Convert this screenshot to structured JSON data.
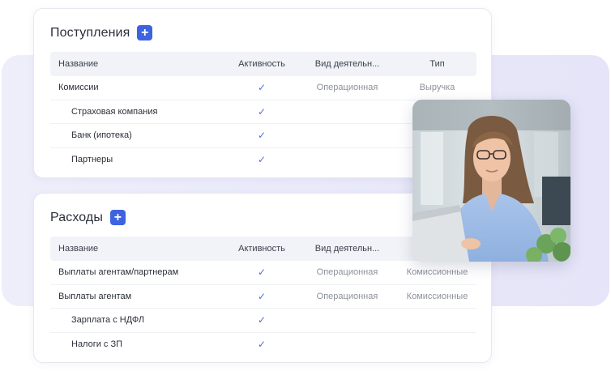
{
  "income": {
    "title": "Поступления",
    "add_icon": "+",
    "columns": {
      "name": "Название",
      "active": "Активность",
      "kind": "Вид деятельн...",
      "type": "Тип"
    },
    "rows": [
      {
        "name": "Комиссии",
        "active": "✓",
        "kind": "Операционная",
        "type": "Выручка"
      },
      {
        "name": "Страховая компания",
        "active": "✓",
        "kind": "",
        "type": ""
      },
      {
        "name": "Банк (ипотека)",
        "active": "✓",
        "kind": "",
        "type": ""
      },
      {
        "name": "Партнеры",
        "active": "✓",
        "kind": "",
        "type": ""
      }
    ]
  },
  "expense": {
    "title": "Расходы",
    "add_icon": "+",
    "columns": {
      "name": "Название",
      "active": "Активность",
      "kind": "Вид деятельн...",
      "type": ""
    },
    "rows": [
      {
        "name": "Выплаты агентам/партнерам",
        "active": "✓",
        "kind": "Операционная",
        "type": "Комиссионные"
      },
      {
        "name": "Выплаты агентам",
        "active": "✓",
        "kind": "Операционная",
        "type": "Комиссионные"
      },
      {
        "name": "Зарплата с НДФЛ",
        "active": "✓",
        "kind": "",
        "type": ""
      },
      {
        "name": "Налоги с ЗП",
        "active": "✓",
        "kind": "",
        "type": ""
      }
    ]
  },
  "colors": {
    "accent": "#3d63e0",
    "check": "#4a6fe0",
    "muted_text": "#8d919c",
    "header_bg": "#f1f3f8"
  },
  "icons": {
    "add": "plus-icon",
    "check": "check-icon"
  }
}
